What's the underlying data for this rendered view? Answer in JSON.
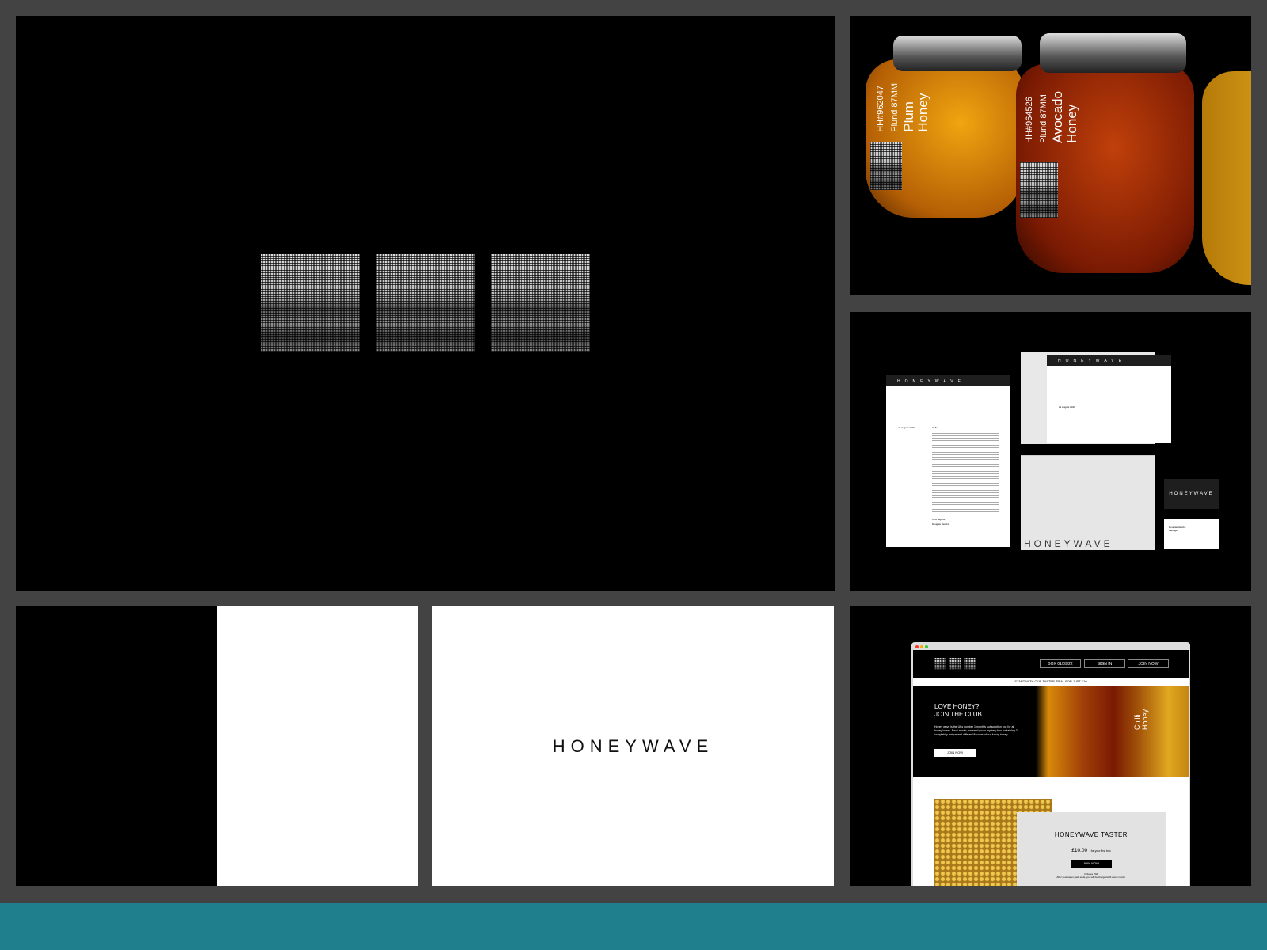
{
  "brand": "HONEYWAVE",
  "jars": [
    {
      "code": "HH#962047",
      "sub": "Plund 87MM",
      "name": "Plum\nHoney"
    },
    {
      "code": "HH#964526",
      "sub": "Plund 87MM",
      "name": "Avocado\nHoney"
    }
  ],
  "stationery": {
    "date": "21 August 2019",
    "greeting": "Hello,",
    "signoff": "Kind regards,",
    "person": "Douglas Jacobs",
    "role": "Manager"
  },
  "website": {
    "nav": [
      "BOX 01/09/22",
      "SIGN IN",
      "JOIN NOW"
    ],
    "banner": "START WITH OUR TASTER TRIAL FOR JUST £10",
    "hero_title_1": "LOVE HONEY?",
    "hero_title_2": "JOIN THE CLUB.",
    "hero_body": "Honey wave is the UKs number 1 monthly subscription box for all honey lovers. Each month, we send you a mystery box containing 3 completely unique and different flavours of our luxury honey.",
    "hero_cta": "JOIN NOW",
    "hero_jar_label": "Chilli\nHoney",
    "taster_title": "HONEYWAVE TASTER",
    "taster_price": "£10.00",
    "taster_price_note": "for your first box",
    "taster_cta": "JOIN NOW",
    "taster_note_1": "Includes P&P",
    "taster_note_2": "After your taster pack ends, you will be charged £24 every month."
  },
  "colors": {
    "frame": "#434343",
    "footer": "#1f7f8c"
  }
}
